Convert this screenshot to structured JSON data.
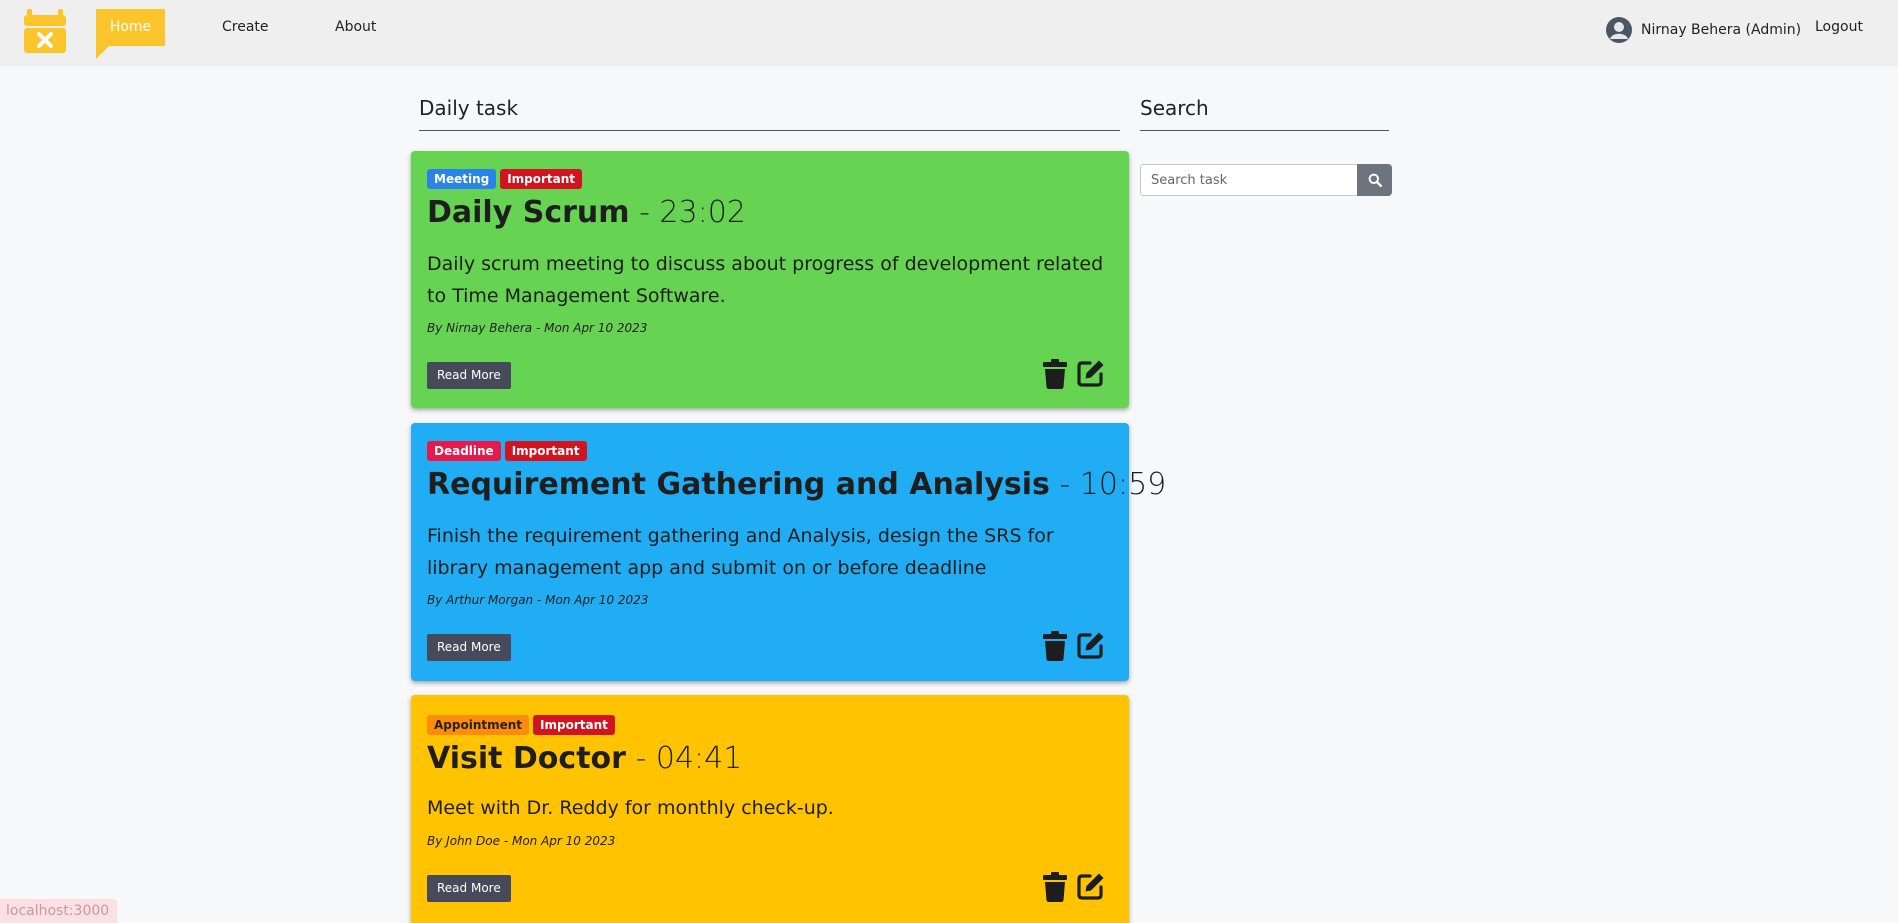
{
  "nav": {
    "home": "Home",
    "create": "Create",
    "about": "About",
    "user_name": "Nirnay Behera (Admin)",
    "logout": "Logout",
    "logo_icon": "calendar-x-icon",
    "accent_color": "#fdc52c"
  },
  "sections": {
    "tasks_title": "Daily task",
    "search_title": "Search"
  },
  "search": {
    "placeholder": "Search task",
    "button_icon": "search-icon"
  },
  "tasks": [
    {
      "badges": [
        {
          "label": "Meeting",
          "color": "#2a83e8"
        },
        {
          "label": "Important",
          "color": "#d1141f"
        }
      ],
      "name": "Daily Scrum",
      "time": "- 23:02",
      "description": "Daily scrum meeting to discuss about progress of development related to Time Management Software.",
      "meta": "By Nirnay Behera -  Mon Apr 10 2023",
      "read_more": "Read More",
      "background": "#66d353"
    },
    {
      "badges": [
        {
          "label": "Deadline",
          "color": "#e5194a"
        },
        {
          "label": "Important",
          "color": "#d1141f"
        }
      ],
      "name": "Requirement Gathering and Analysis",
      "time": "- 10:59",
      "description": "Finish the requirement gathering and Analysis, design the SRS for library management app and submit on or before deadline",
      "meta": "By Arthur Morgan -  Mon Apr 10 2023",
      "read_more": "Read More",
      "background": "#21adf3"
    },
    {
      "badges": [
        {
          "label": "Appointment",
          "color": "#fd8c0c"
        },
        {
          "label": "Important",
          "color": "#d1141f"
        }
      ],
      "name": "Visit Doctor",
      "time": "- 04:41",
      "description": "Meet with Dr. Reddy for monthly check-up.",
      "meta": "By John Doe -  Mon Apr 10 2023",
      "read_more": "Read More",
      "background": "#ffc302"
    }
  ],
  "status_bar": "localhost:3000"
}
